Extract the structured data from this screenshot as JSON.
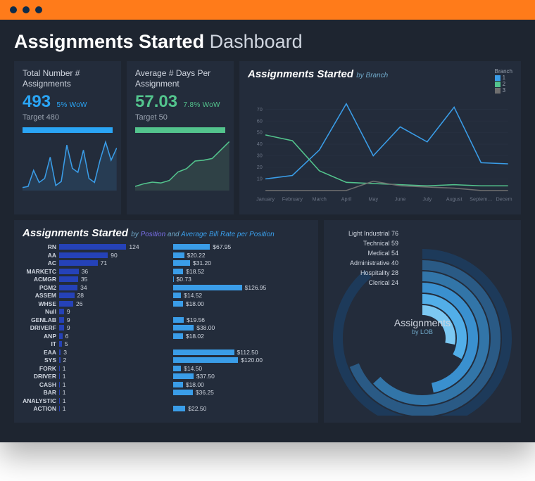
{
  "page_title_bold": "Assignments Started",
  "page_title_rest": "Dashboard",
  "kpi1": {
    "label": "Total Number # Assignments",
    "value": "493",
    "delta": "5% WoW",
    "target": "Target 480"
  },
  "kpi2": {
    "label": "Average # Days Per Assignment",
    "value": "57.03",
    "delta": "7.8% WoW",
    "target": "Target 50"
  },
  "branch_title": "Assignments Started",
  "branch_sub": "by Branch",
  "branch_legend_title": "Branch",
  "branch_legend": [
    "1",
    "2",
    "3"
  ],
  "bars_title": "Assignments Started",
  "bars_sub_by": "by",
  "bars_sub_pos": "Position",
  "bars_sub_and": "and",
  "bars_sub_avg": "Average",
  "bars_sub_rate": "Bill Rate per Position",
  "lob_title": "Assignments",
  "lob_sub": "by LOB",
  "lob_labels": [
    "Light Industrial 76",
    "Technical 59",
    "Medical 54",
    "Administrative 40",
    "Hospitality 28",
    "Clerical 24"
  ],
  "chart_data": [
    {
      "type": "line",
      "name": "kpi1_sparkline",
      "ylim": [
        0,
        50
      ],
      "values": [
        3,
        4,
        20,
        8,
        12,
        33,
        5,
        9,
        45,
        22,
        18,
        40,
        12,
        8,
        30,
        48,
        30,
        42
      ]
    },
    {
      "type": "line",
      "name": "kpi2_sparkline",
      "ylim": [
        0,
        60
      ],
      "values": [
        5,
        8,
        10,
        9,
        12,
        22,
        26,
        35,
        36,
        38,
        48,
        58
      ]
    },
    {
      "type": "line",
      "name": "branch",
      "x": [
        "January",
        "February",
        "March",
        "April",
        "May",
        "June",
        "July",
        "August",
        "Septem…",
        "Decemb…"
      ],
      "y_ticks": [
        10,
        20,
        30,
        40,
        50,
        60,
        70
      ],
      "ylim": [
        0,
        80
      ],
      "series": [
        {
          "name": "1",
          "color": "#3a9de8",
          "values": [
            10,
            13,
            35,
            75,
            30,
            55,
            42,
            72,
            24,
            23
          ]
        },
        {
          "name": "2",
          "color": "#53c48d",
          "values": [
            48,
            43,
            17,
            7,
            6,
            5,
            4,
            5,
            4,
            4
          ]
        },
        {
          "name": "3",
          "color": "#6f6f6f",
          "values": [
            0,
            0,
            0,
            0,
            8,
            4,
            3,
            2,
            0,
            0
          ]
        }
      ]
    },
    {
      "type": "bar",
      "name": "assignments_by_position",
      "orientation": "horizontal",
      "categories": [
        "RN",
        "AA",
        "AC",
        "MARKETC",
        "ACMGR",
        "PGM2",
        "ASSEM",
        "WHSE",
        "Null",
        "GENLAB",
        "DRIVERF",
        "ANP",
        "IT",
        "EAA",
        "SYS",
        "FORK",
        "DRIVER",
        "CASH",
        "BAR",
        "ANALYSTIC",
        "ACTION"
      ],
      "values": [
        124,
        90,
        71,
        36,
        35,
        34,
        28,
        26,
        9,
        9,
        9,
        6,
        5,
        3,
        2,
        1,
        1,
        1,
        1,
        1,
        1
      ],
      "xlim": [
        0,
        130
      ]
    },
    {
      "type": "bar",
      "name": "avg_bill_rate_per_position",
      "orientation": "horizontal",
      "categories": [
        "RN",
        "AA",
        "AC",
        "MARKETC",
        "ACMGR",
        "PGM2",
        "ASSEM",
        "WHSE",
        "Null",
        "GENLAB",
        "DRIVERF",
        "ANP",
        "IT",
        "EAA",
        "SYS",
        "FORK",
        "DRIVER",
        "CASH",
        "BAR",
        "ANALYSTIC",
        "ACTION"
      ],
      "values": [
        67.95,
        20.22,
        31.2,
        18.52,
        0.73,
        126.95,
        14.52,
        18.0,
        null,
        19.56,
        38.0,
        18.02,
        null,
        112.5,
        120.0,
        14.5,
        37.5,
        18.0,
        36.25,
        null,
        22.5
      ],
      "xlim": [
        0,
        130
      ],
      "value_prefix": "$"
    },
    {
      "type": "pie",
      "name": "assignments_by_lob",
      "style": "radial_bar",
      "categories": [
        "Light Industrial",
        "Technical",
        "Medical",
        "Administrative",
        "Hospitality",
        "Clerical"
      ],
      "values": [
        76,
        59,
        54,
        40,
        28,
        24
      ],
      "colors": [
        "#1d3a5a",
        "#2a5a85",
        "#3275a8",
        "#3a90cf",
        "#52aee8",
        "#7cc8f2"
      ]
    }
  ],
  "colors": {
    "accent_blue": "#2aa5f5",
    "accent_green": "#53c48d",
    "bg_card": "#232c3b",
    "bg_page": "#1e2530"
  }
}
